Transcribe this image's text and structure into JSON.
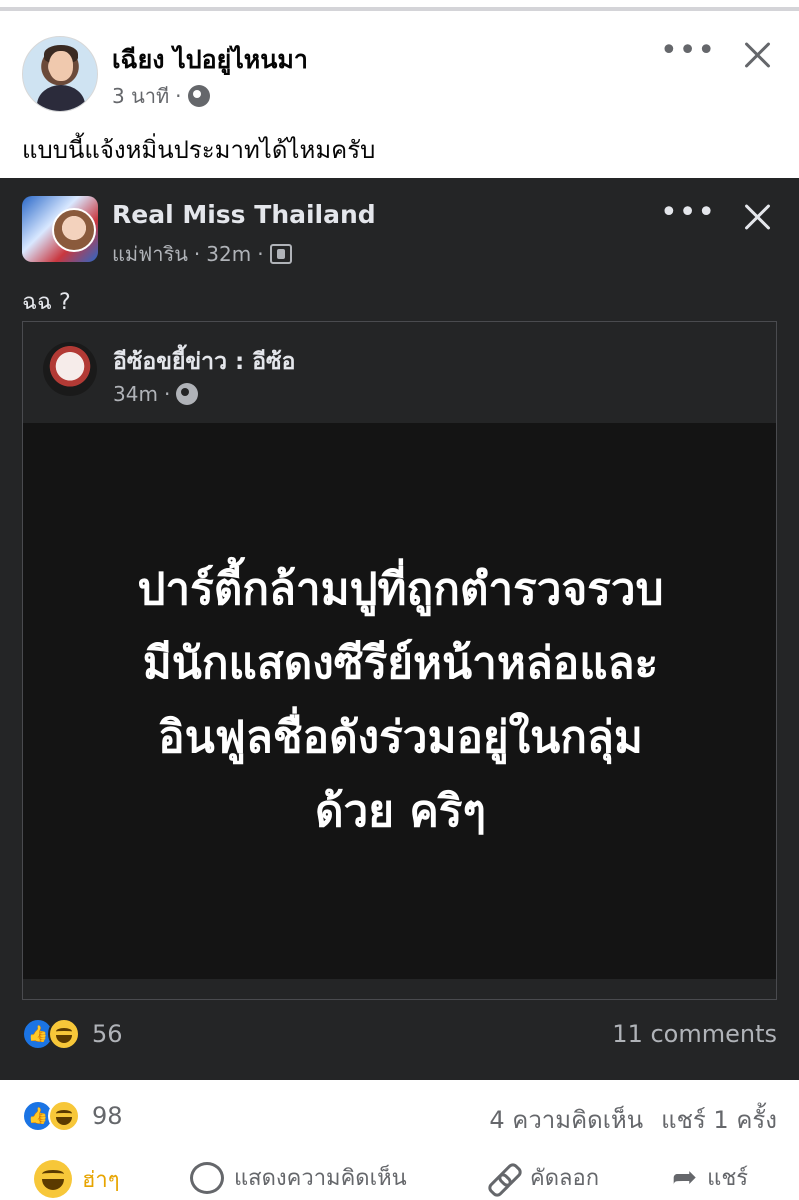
{
  "outer_post": {
    "author": "เฉียง ไปอยู่ไหนมา",
    "time": "3 นาที",
    "caption": "แบบนี้แจ้งหมิ่นประมาทได้ไหมครับ",
    "reaction_count": "98",
    "comments": "4 ความคิดเห็น",
    "shares": "แชร์ 1 ครั้ง"
  },
  "shared_post": {
    "page_name": "Real Miss Thailand",
    "author": "แม่ฟาริน",
    "time": "32m",
    "caption": "ฉฉ ?",
    "reaction_count": "56",
    "comments": "11 comments"
  },
  "original_post": {
    "author": "อีซ้อขยี้ข่าว : อีซ้อ",
    "time": "34m",
    "image_lines": [
      "ปาร์ตี้กล้ามปูที่ถูกตำรวจรวบ",
      "มีนักแสดงซีรีย์หน้าหล่อและ",
      "อินฟูลชื่อดังร่วมอยู่ในกลุ่ม",
      "ด้วย คริๆ"
    ]
  },
  "actions": {
    "haha": "ฮ่าๆ",
    "comment": "แสดงความคิดเห็น",
    "copy": "คัดลอก",
    "share": "แชร์"
  },
  "misc": {
    "dot_separator": "·",
    "more_glyph": "•••"
  }
}
